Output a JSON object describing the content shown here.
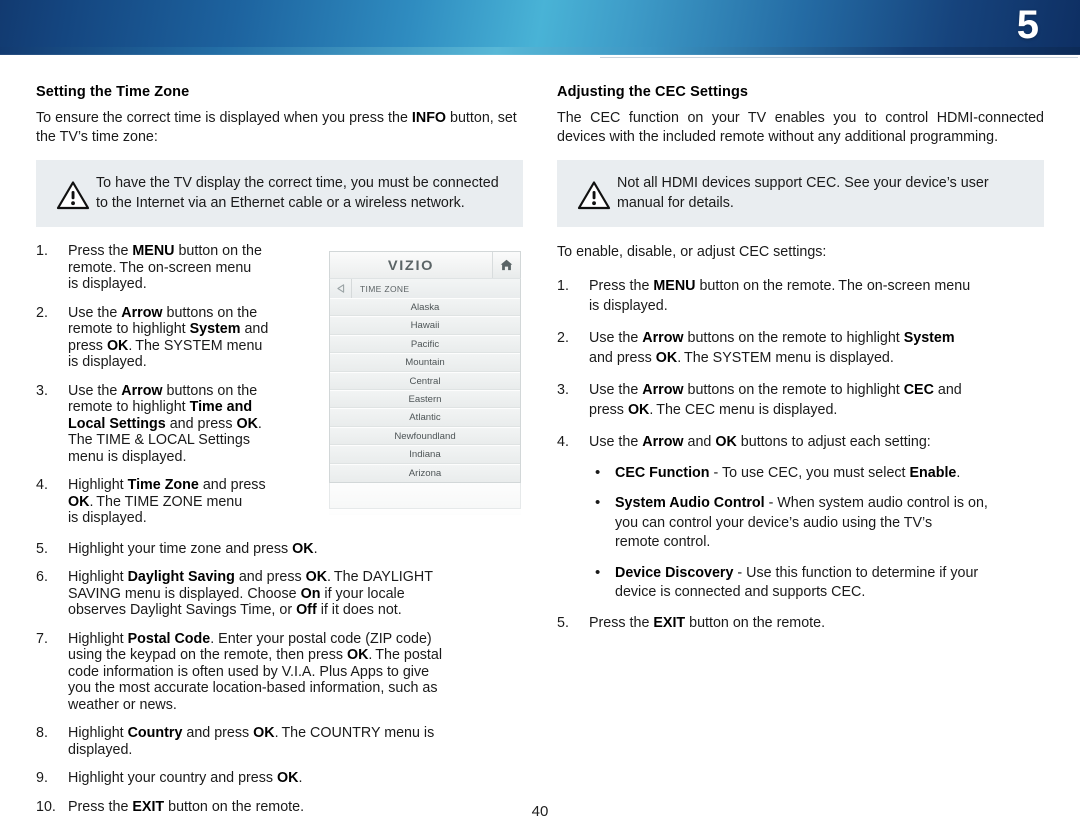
{
  "header": {
    "chapter_number": "5"
  },
  "footer": {
    "page_number": "40"
  },
  "left_column": {
    "title": "Setting the Time Zone",
    "intro_html": "To ensure the correct time is displayed when you press the <b>INFO</b> button, set the TV’s time zone:",
    "note": {
      "icon": "warning-triangle-icon",
      "text": "To have the TV display the correct time, you must be connected to the Internet via an Ethernet cable or a wireless network."
    },
    "steps": [
      {
        "num": "1.",
        "html": "Press the <b>MENU</b> button on the<br>remote. The on-screen menu<br>is displayed."
      },
      {
        "num": "2.",
        "html": "Use the <b>Arrow</b> buttons on the<br>remote to highlight <b>System</b> and<br>press <b>OK</b>. The SYSTEM menu<br>is displayed."
      },
      {
        "num": "3.",
        "html": "Use the <b>Arrow</b> buttons on the<br>remote to highlight <b>Time and</b><br><b>Local Settings</b> and press <b>OK</b>.<br>The TIME &amp; LOCAL Settings<br>menu is displayed."
      },
      {
        "num": "4.",
        "html": "Highlight <b>Time Zone</b> and press<br><b>OK</b>. The TIME ZONE menu<br>is displayed."
      },
      {
        "num": "5.",
        "html": "Highlight your time zone and press <b>OK</b>."
      },
      {
        "num": "6.",
        "html": "Highlight <b>Daylight Saving</b> and press <b>OK</b>. The DAYLIGHT<br>SAVING menu is displayed. Choose <b>On</b> if your locale<br>observes Daylight Savings Time, or <b>Off</b> if it does not."
      },
      {
        "num": "7.",
        "html": "Highlight <b>Postal Code</b>. Enter your postal code (ZIP code)<br>using the keypad on the remote, then press <b>OK</b>. The postal<br>code information is often used by V.I.A. Plus Apps to give<br>you the most accurate location-based information, such as<br>weather or news."
      },
      {
        "num": "8.",
        "html": "Highlight <b>Country</b> and press <b>OK</b>. The COUNTRY menu is<br>displayed."
      },
      {
        "num": "9.",
        "html": "Highlight your country and press <b>OK</b>."
      },
      {
        "num": "10.",
        "html": "Press the <b>EXIT</b> button on the remote."
      }
    ]
  },
  "tv_menu": {
    "logo": "VIZIO",
    "home_icon": "home-icon",
    "back_icon": "back-arrow-icon",
    "breadcrumb": "TIME ZONE",
    "rows": [
      "Alaska",
      "Hawaii",
      "Pacific",
      "Mountain",
      "Central",
      "Eastern",
      "Atlantic",
      "Newfoundland",
      "Indiana",
      "Arizona"
    ]
  },
  "right_column": {
    "title": "Adjusting the CEC Settings",
    "intro": "The CEC function on your TV enables you to control HDMI-connected devices with the included remote without any additional programming.",
    "note": {
      "icon": "warning-triangle-icon",
      "text": "Not all HDMI devices support CEC. See your device’s user manual for details."
    },
    "lead_in": "To enable, disable, or adjust CEC settings:",
    "steps": [
      {
        "num": "1.",
        "html": "Press the <b>MENU</b> button on the remote. The on-screen menu<br>is displayed."
      },
      {
        "num": "2.",
        "html": "Use the <b>Arrow</b> buttons on the remote to highlight <b>System</b><br>and press <b>OK</b>. The SYSTEM menu is displayed."
      },
      {
        "num": "3.",
        "html": "Use the <b>Arrow</b> buttons on the remote to highlight <b>CEC</b> and<br>press <b>OK</b>. The CEC menu is displayed."
      },
      {
        "num": "4.",
        "html": "Use the <b>Arrow</b> and <b>OK</b> buttons to adjust each setting:"
      }
    ],
    "bullets": [
      {
        "html": "<b>CEC Function</b> - To use CEC, you must select <b>Enable</b>."
      },
      {
        "html": "<b>System Audio Control</b> - When system audio control is on,<br>you can control your device’s audio using the TV’s<br>remote control."
      },
      {
        "html": "<b>Device Discovery</b> - Use this function to determine if your<br>device is connected and supports CEC."
      }
    ],
    "final_step": {
      "num": "5.",
      "html": "Press the <b>EXIT</b> button on the remote."
    }
  }
}
